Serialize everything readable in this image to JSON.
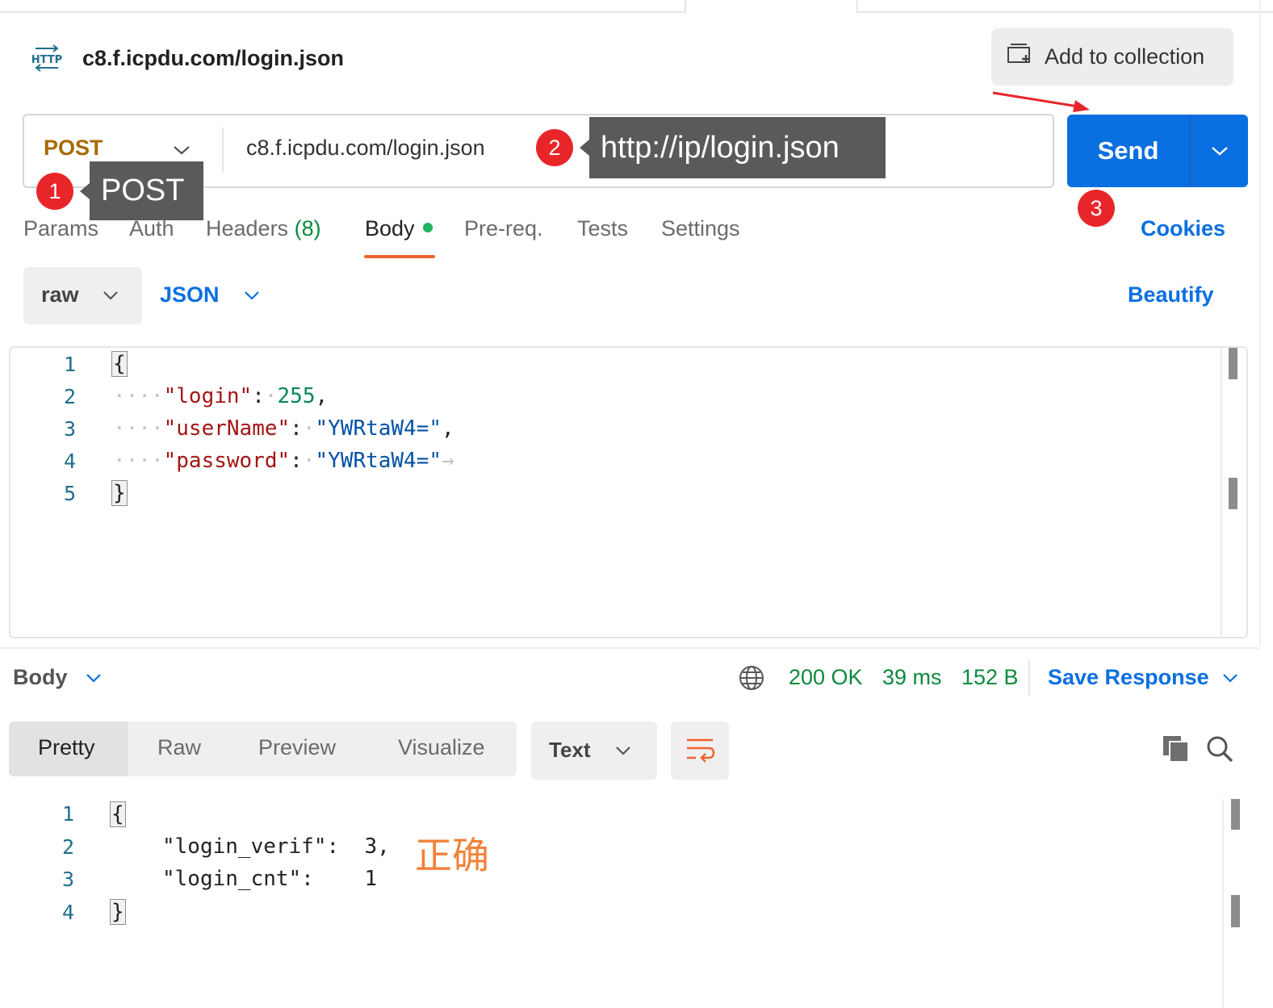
{
  "request": {
    "protocol_icon": "http-icon",
    "name": "c8.f.icpdu.com/login.json",
    "add_to_collection": "Add to collection",
    "method": "POST",
    "url": "c8.f.icpdu.com/login.json",
    "send": "Send"
  },
  "annotations": {
    "badge1": "1",
    "callout1": "POST",
    "badge2": "2",
    "callout2": "http://ip/login.json",
    "badge3": "3",
    "note_correct": "正确"
  },
  "request_tabs": {
    "params": "Params",
    "auth": "Auth",
    "headers": "Headers",
    "headers_count": "(8)",
    "body": "Body",
    "prereq": "Pre-req.",
    "tests": "Tests",
    "settings": "Settings",
    "cookies": "Cookies"
  },
  "body_mode": {
    "mode": "raw",
    "language": "JSON",
    "beautify": "Beautify"
  },
  "request_body": {
    "line_numbers": [
      "1",
      "2",
      "3",
      "4",
      "5"
    ],
    "open_brace": "{",
    "close_brace": "}",
    "indent": "····",
    "key1": "\"login\"",
    "val1": "255",
    "key2": "\"userName\"",
    "val2": "\"YWRtaW4=\"",
    "key3": "\"password\"",
    "val3": "\"YWRtaW4=\"",
    "colon": ":",
    "comma": ",",
    "arrow": "→"
  },
  "response": {
    "section": "Body",
    "status": "200 OK",
    "time": "39 ms",
    "size": "152 B",
    "save": "Save Response",
    "views": [
      "Pretty",
      "Raw",
      "Preview",
      "Visualize"
    ],
    "format": "Text",
    "line_numbers": [
      "1",
      "2",
      "3",
      "4"
    ],
    "open_brace": "{",
    "close_brace": "}",
    "line2": "\"login_verif\":  3,",
    "line3": "\"login_cnt\":    1"
  },
  "colors": {
    "accent": "#0a6fe0",
    "method_post": "#a66a00",
    "status_ok": "#0b8a3e",
    "active_tab_underline": "#f0632b",
    "annotation_red": "#e8262a"
  }
}
